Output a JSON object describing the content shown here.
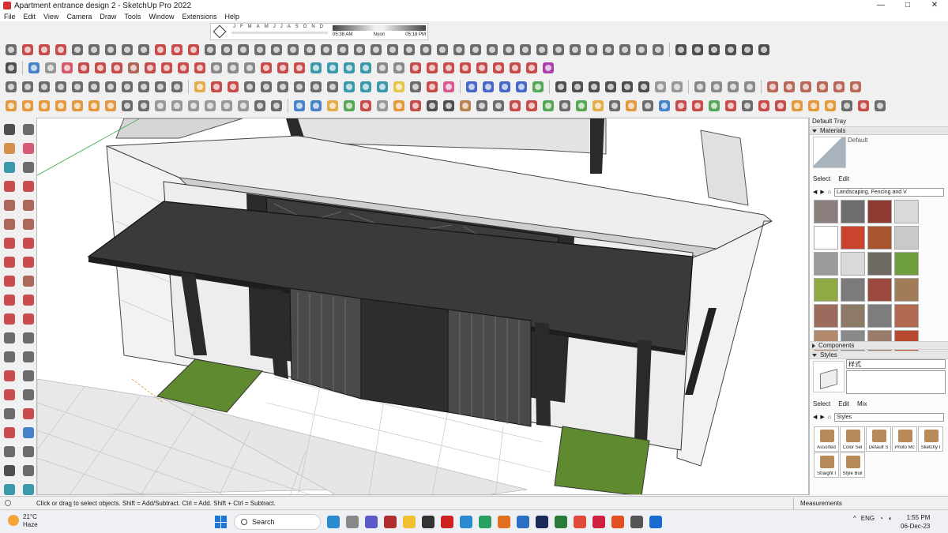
{
  "window": {
    "title": "Apartment entrance design 2 - SketchUp Pro 2022",
    "controls": [
      "—",
      "□",
      "✕"
    ]
  },
  "menu": [
    "File",
    "Edit",
    "View",
    "Camera",
    "Draw",
    "Tools",
    "Window",
    "Extensions",
    "Help"
  ],
  "shadows": {
    "months": [
      "J",
      "F",
      "M",
      "A",
      "M",
      "J",
      "J",
      "A",
      "S",
      "O",
      "N",
      "D"
    ],
    "time_start": "05:38 AM",
    "time_mid": "Noon",
    "time_end": "05:18 PM"
  },
  "viewport": {
    "scene": "3D model of apartment entrance with canopy, dark gates, tiled walls and two grass planters"
  },
  "tray": {
    "title": "Default Tray",
    "materials": {
      "header": "Materials",
      "current_name": "Default",
      "select_tab": "Select",
      "edit_tab": "Edit",
      "library": "Landscaping, Fencing and V"
    },
    "components": {
      "header": "Components"
    },
    "styles": {
      "header": "Styles",
      "current_name": "样式",
      "select_tab": "Select",
      "edit_tab": "Edit",
      "mix_tab": "Mix",
      "library": "Styles",
      "items": [
        "Assorted",
        "Color Sel",
        "Default S",
        "Photo Mc",
        "Sketchy I",
        "Straight I",
        "Style Buil"
      ]
    }
  },
  "swatch_colors": [
    "#8a7f7c",
    "#6d6d6d",
    "#8c3a32",
    "#d9d9d9",
    "#ffffff",
    "#c8442e",
    "#a8542c",
    "#c9c9c9",
    "#9a9a9a",
    "#d9d9d9",
    "#6e6a63",
    "#6d9d3c",
    "#8faa42",
    "#7b7b7b",
    "#9c4a3e",
    "#a07d58",
    "#9c6b5e",
    "#8c7a66",
    "#7d7d7d",
    "#b06a52",
    "#b48a6c",
    "#8a8a8a",
    "#9b7b6a",
    "#b8482e"
  ],
  "status": {
    "message": "Click or drag to select objects. Shift = Add/Subtract. Ctrl = Add. Shift + Ctrl = Subtract.",
    "measurements": "Measurements"
  },
  "taskbar": {
    "temp": "21°C",
    "weather": "Haze",
    "search": "Search",
    "time": "1:55 PM",
    "date": "06-Dec-23",
    "lang": "ENG"
  }
}
